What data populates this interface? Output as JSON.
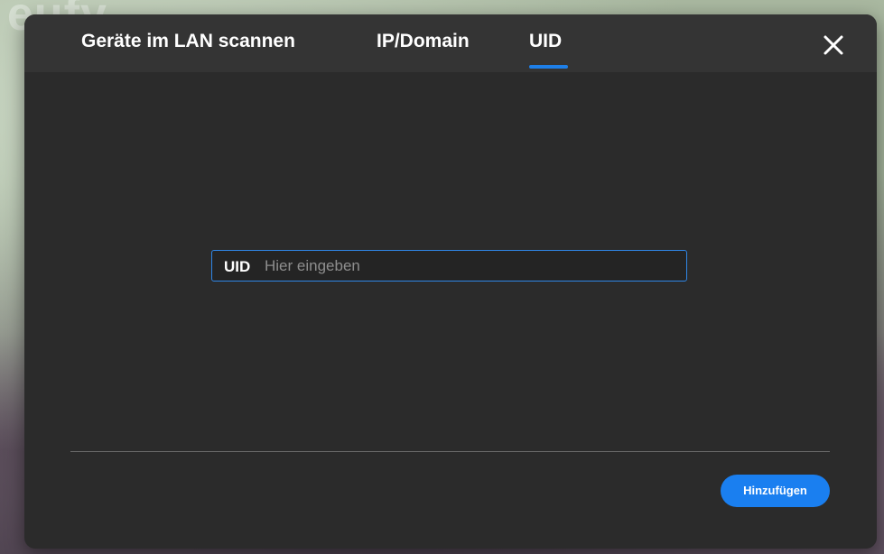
{
  "dialog": {
    "tabs": [
      {
        "label": "Geräte im LAN scannen",
        "active": false
      },
      {
        "label": "IP/Domain",
        "active": false
      },
      {
        "label": "UID",
        "active": true
      }
    ],
    "close_icon": "close-icon"
  },
  "uid_field": {
    "label": "UID",
    "value": "",
    "placeholder": "Hier eingeben"
  },
  "footer": {
    "add_label": "Hinzufügen"
  },
  "colors": {
    "accent": "#1a7ff0",
    "dialog_bg": "#2b2b2b",
    "tabbar_bg": "#343434",
    "text": "#ffffff",
    "placeholder": "#8e8e8e"
  }
}
